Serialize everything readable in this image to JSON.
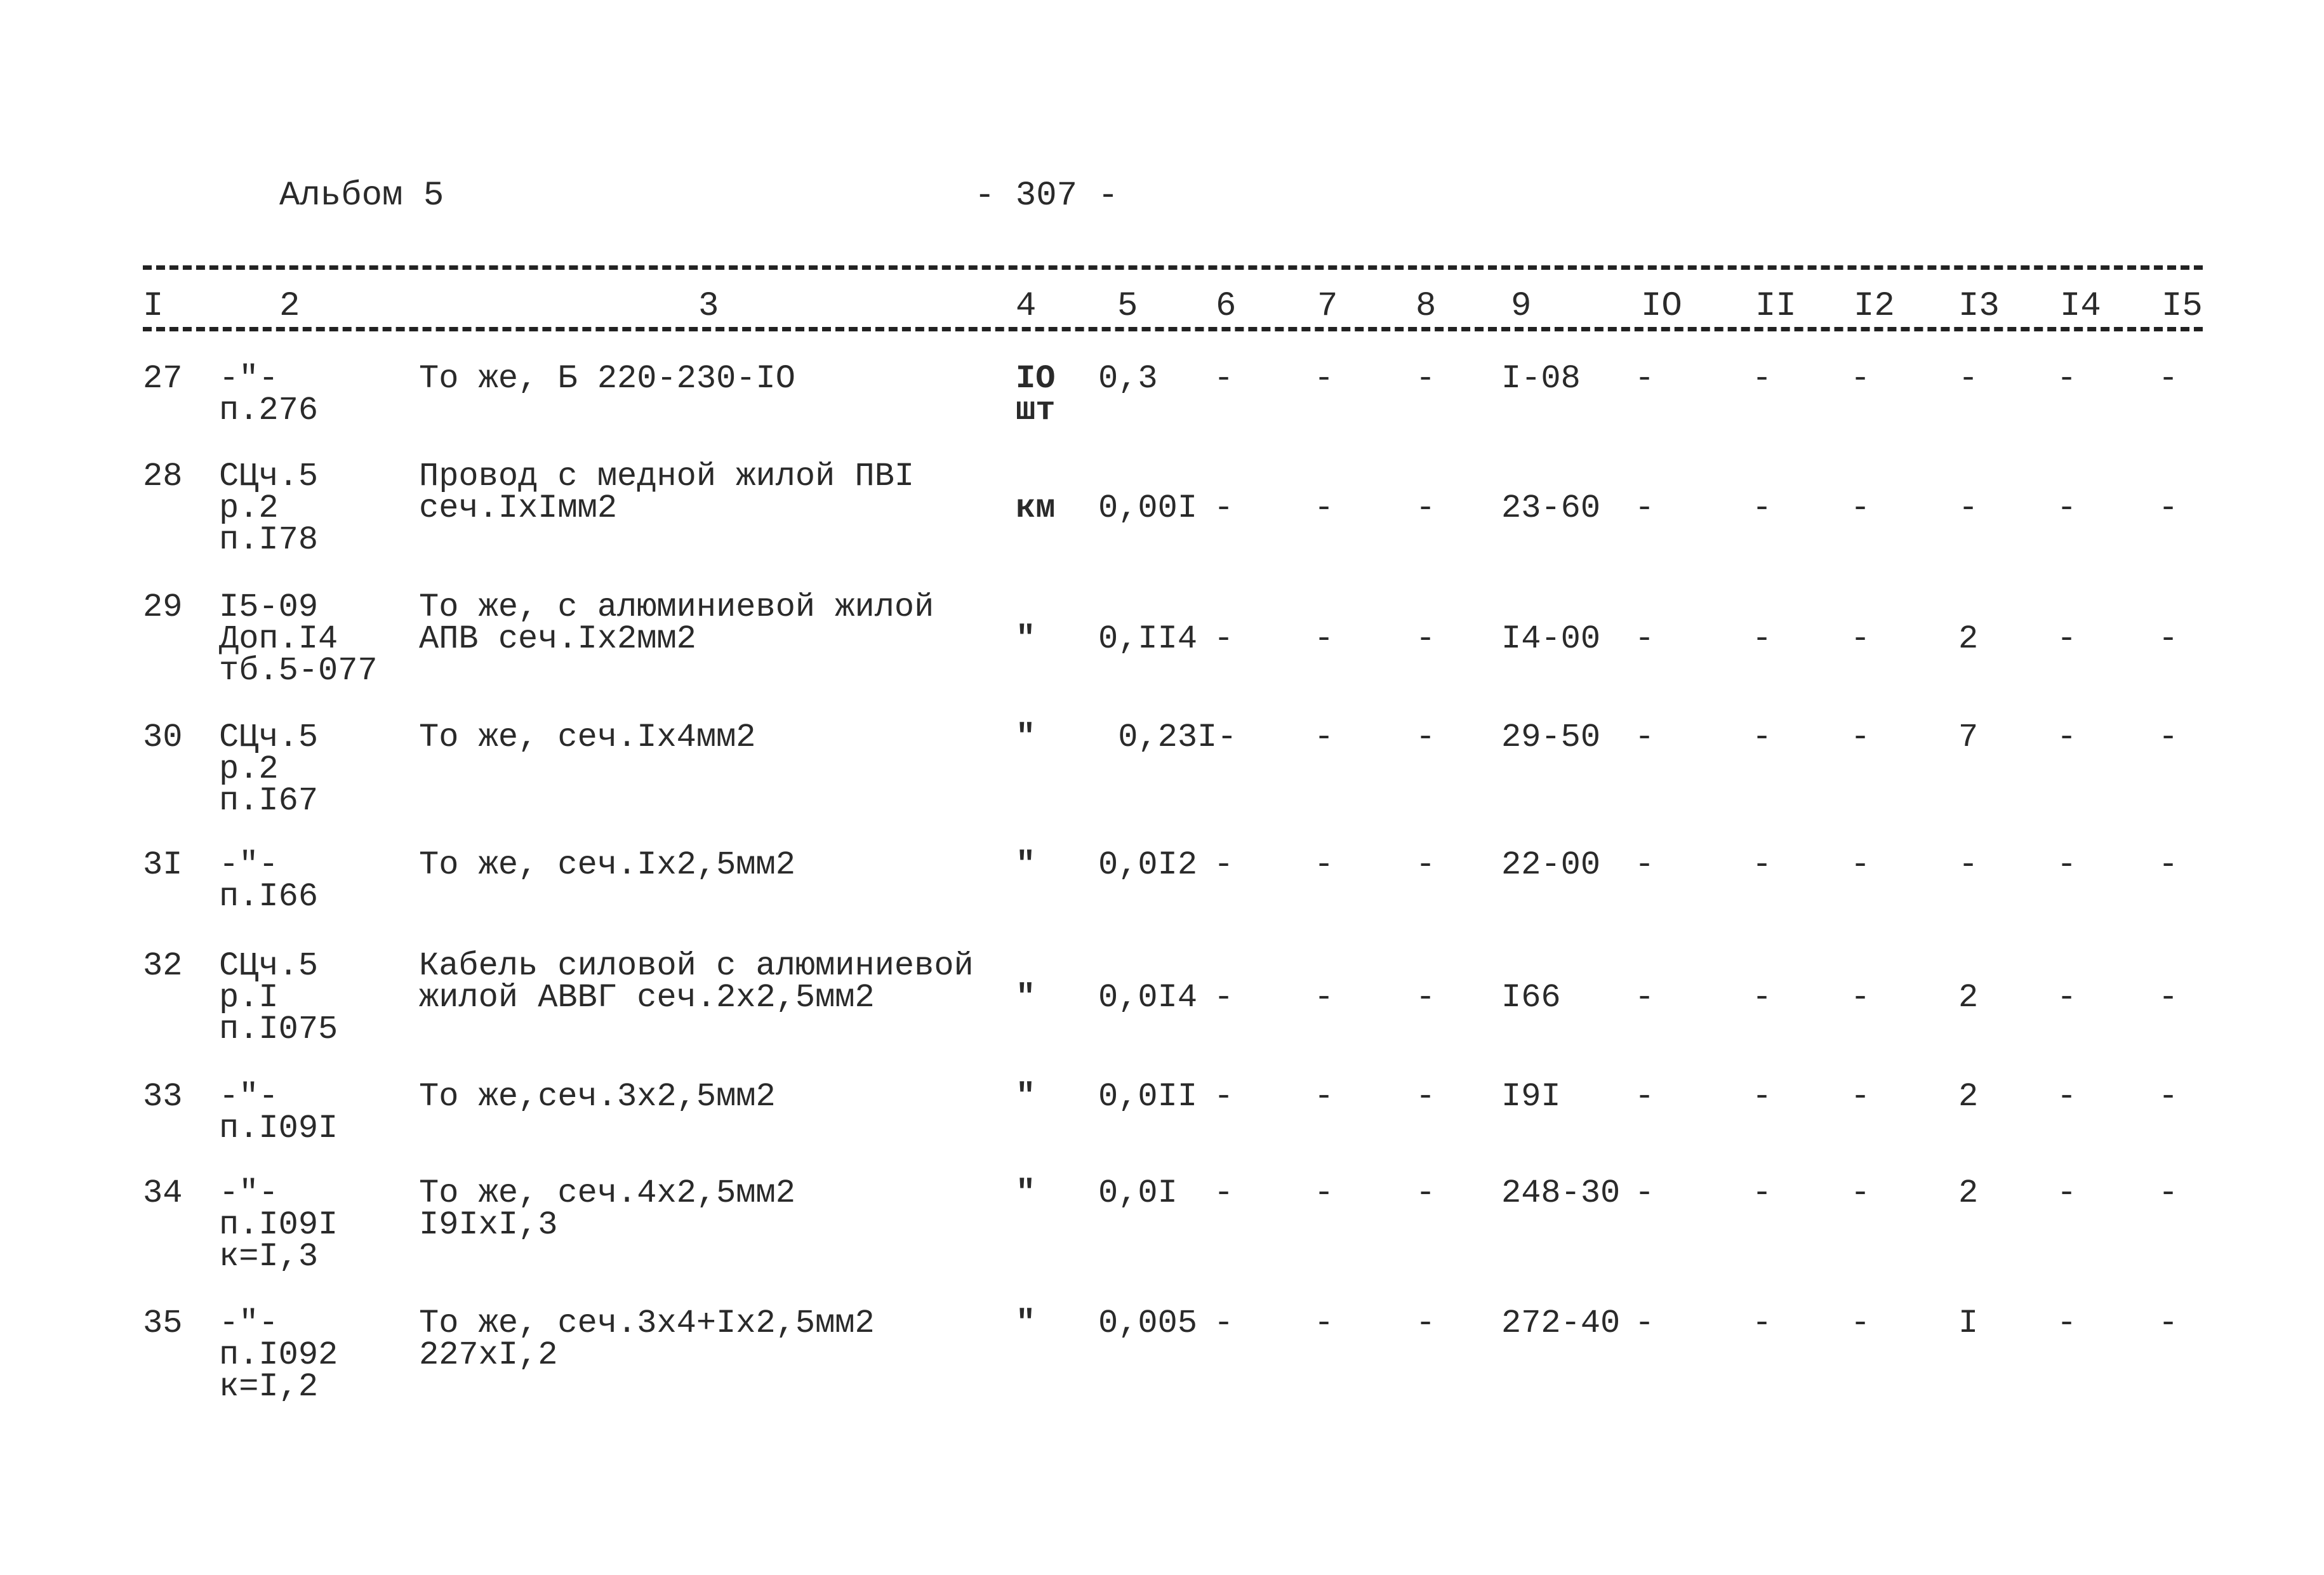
{
  "header": {
    "album": "Альбом 5",
    "page_number": "- 307 -"
  },
  "columns": [
    "I",
    "2",
    "3",
    "4",
    "5",
    "6",
    "7",
    "8",
    "9",
    "IO",
    "II",
    "I2",
    "I3",
    "I4",
    "I5"
  ],
  "rows": [
    {
      "c1": "27",
      "c2": "-\"-\nп.276",
      "c3": "То же, Б 220-230-IO",
      "c4": "IO\nшт",
      "c5": "0,3",
      "c6": "-",
      "c7": "-",
      "c8": "-",
      "c9": "I-08",
      "c10": "-",
      "c11": "-",
      "c12": "-",
      "c13": "-",
      "c14": "-",
      "c15": "-"
    },
    {
      "c1": "28",
      "c2": "СЦч.5\nр.2\nп.I78",
      "c3": "Провод с медной жилой ПВI\nсеч.IxIмм2",
      "c4": "\nкм",
      "c5": "\n0,00I",
      "c6": "\n-",
      "c7": "\n-",
      "c8": "\n-",
      "c9": "\n23-60",
      "c10": "\n-",
      "c11": "\n-",
      "c12": "\n-",
      "c13": "\n-",
      "c14": "\n-",
      "c15": "\n-"
    },
    {
      "c1": "29",
      "c2": "I5-09\nДоп.I4\nтб.5-077",
      "c3": "То же, с алюминиевой жилой\nАПВ сеч.Ix2мм2",
      "c4": "\n\"",
      "c5": "\n0,II4",
      "c6": "\n-",
      "c7": "\n-",
      "c8": "\n-",
      "c9": "\nI4-00",
      "c10": "\n-",
      "c11": "\n-",
      "c12": "\n-",
      "c13": "\n2",
      "c14": "\n-",
      "c15": "\n-"
    },
    {
      "c1": "30",
      "c2": "СЦч.5\nр.2\nп.I67",
      "c3": "То же, сеч.Ix4мм2",
      "c4": "\"",
      "c5": " 0,23I-",
      "c6": "",
      "c7": "-",
      "c8": "-",
      "c9": "29-50",
      "c10": "-",
      "c11": "-",
      "c12": "-",
      "c13": "7",
      "c14": "-",
      "c15": "-"
    },
    {
      "c1": "3I",
      "c2": "-\"-\nп.I66",
      "c3": "То же, сеч.Ix2,5мм2",
      "c4": "\"",
      "c5": "0,0I2",
      "c6": "-",
      "c7": "-",
      "c8": "-",
      "c9": "22-00",
      "c10": "-",
      "c11": "-",
      "c12": "-",
      "c13": "-",
      "c14": "-",
      "c15": "-"
    },
    {
      "c1": "32",
      "c2": "СЦч.5\nр.I\nп.I075",
      "c3": "Кабель силовой с алюминиевой\nжилой АВВГ сеч.2x2,5мм2",
      "c4": "\n\"",
      "c5": "\n0,0I4",
      "c6": "\n-",
      "c7": "\n-",
      "c8": "\n-",
      "c9": "\nI66",
      "c10": "\n-",
      "c11": "\n-",
      "c12": "\n-",
      "c13": "\n2",
      "c14": "\n-",
      "c15": "\n-"
    },
    {
      "c1": "33",
      "c2": "-\"-\nп.I09I",
      "c3": "То же,сеч.3x2,5мм2",
      "c4": "\"",
      "c5": "0,0II",
      "c6": "-",
      "c7": "-",
      "c8": "-",
      "c9": "I9I",
      "c10": "-",
      "c11": "-",
      "c12": "-",
      "c13": "2",
      "c14": "-",
      "c15": "-"
    },
    {
      "c1": "34",
      "c2": "-\"-\nп.I09I\nк=I,3",
      "c3": "То же, сеч.4x2,5мм2\nI9IxI,3",
      "c4": "\"",
      "c5": "0,0I",
      "c6": "-",
      "c7": "-",
      "c8": "-",
      "c9": "248-30",
      "c10": "-",
      "c11": "-",
      "c12": "-",
      "c13": "2",
      "c14": "-",
      "c15": "-"
    },
    {
      "c1": "35",
      "c2": "-\"-\nп.I092\nк=I,2",
      "c3": "То же, сеч.3x4+Ix2,5мм2\n227xI,2",
      "c4": "\"",
      "c5": "0,005",
      "c6": "-",
      "c7": "-",
      "c8": "-",
      "c9": "272-40",
      "c10": "-",
      "c11": "-",
      "c12": "-",
      "c13": "I",
      "c14": "-",
      "c15": "-"
    }
  ]
}
